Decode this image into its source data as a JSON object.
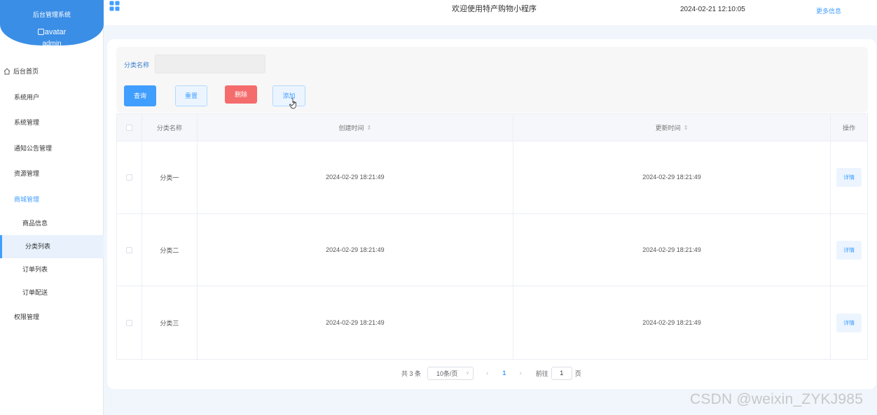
{
  "sidebar": {
    "brand_title": "后台管理系统",
    "avatar_alt": "avatar",
    "username": "admin",
    "menu": [
      {
        "label": "后台首页"
      },
      {
        "label": "系统用户"
      },
      {
        "label": "系统管理"
      },
      {
        "label": "通知公告管理"
      },
      {
        "label": "资源管理"
      },
      {
        "label": "商城管理"
      },
      {
        "label": "商品信息"
      },
      {
        "label": "分类列表"
      },
      {
        "label": "订单列表"
      },
      {
        "label": "订单配送"
      },
      {
        "label": "权限管理"
      }
    ]
  },
  "header": {
    "welcome": "欢迎使用特产购物小程序",
    "datetime": "2024-02-21 12:10:05",
    "more": "更多信息"
  },
  "filter": {
    "label": "分类名称",
    "value": "",
    "placeholder": "",
    "buttons": {
      "query": "查询",
      "reset": "重置",
      "delete": "删除",
      "add": "添加"
    }
  },
  "table": {
    "headers": {
      "name": "分类名称",
      "created": "创建时间",
      "updated": "更新时间",
      "op": "操作"
    },
    "rows": [
      {
        "name": "分类一",
        "created": "2024-02-29 18:21:49",
        "updated": "2024-02-29 18:21:49",
        "action": "详情"
      },
      {
        "name": "分类二",
        "created": "2024-02-29 18:21:49",
        "updated": "2024-02-29 18:21:49",
        "action": "详情"
      },
      {
        "name": "分类三",
        "created": "2024-02-29 18:21:49",
        "updated": "2024-02-29 18:21:49",
        "action": "详情"
      }
    ]
  },
  "pagination": {
    "total": "共 3 条",
    "page_size": "10条/页",
    "current_page": "1",
    "goto_prefix": "前往",
    "goto_value": "1",
    "goto_suffix": "页"
  },
  "colors": {
    "primary": "#409eff",
    "danger": "#f56c6c",
    "brand": "#3a8ee6"
  },
  "watermark": "CSDN @weixin_ZYKJ985"
}
